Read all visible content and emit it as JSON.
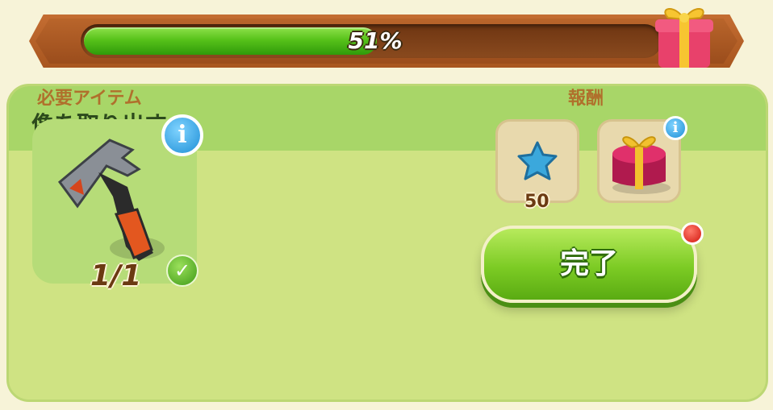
{
  "progress": {
    "label": "51%",
    "value_percent": 51
  },
  "panel": {
    "title": "像を取り出す"
  },
  "required": {
    "label": "必要アイテム",
    "item_icon": "hammer-icon",
    "count": "1/1",
    "info_glyph": "i",
    "check_glyph": "✓"
  },
  "reward": {
    "label": "報酬",
    "items": [
      {
        "icon": "blue-star-icon",
        "count": "50"
      },
      {
        "icon": "gift-box-icon",
        "info_glyph": "i"
      }
    ]
  },
  "button": {
    "label": "完了"
  },
  "colors": {
    "progress_fill": "#57c21a",
    "banner": "#b9652b",
    "panel": "#cfe383",
    "header": "#a8d668",
    "button": "#7ccb24"
  }
}
